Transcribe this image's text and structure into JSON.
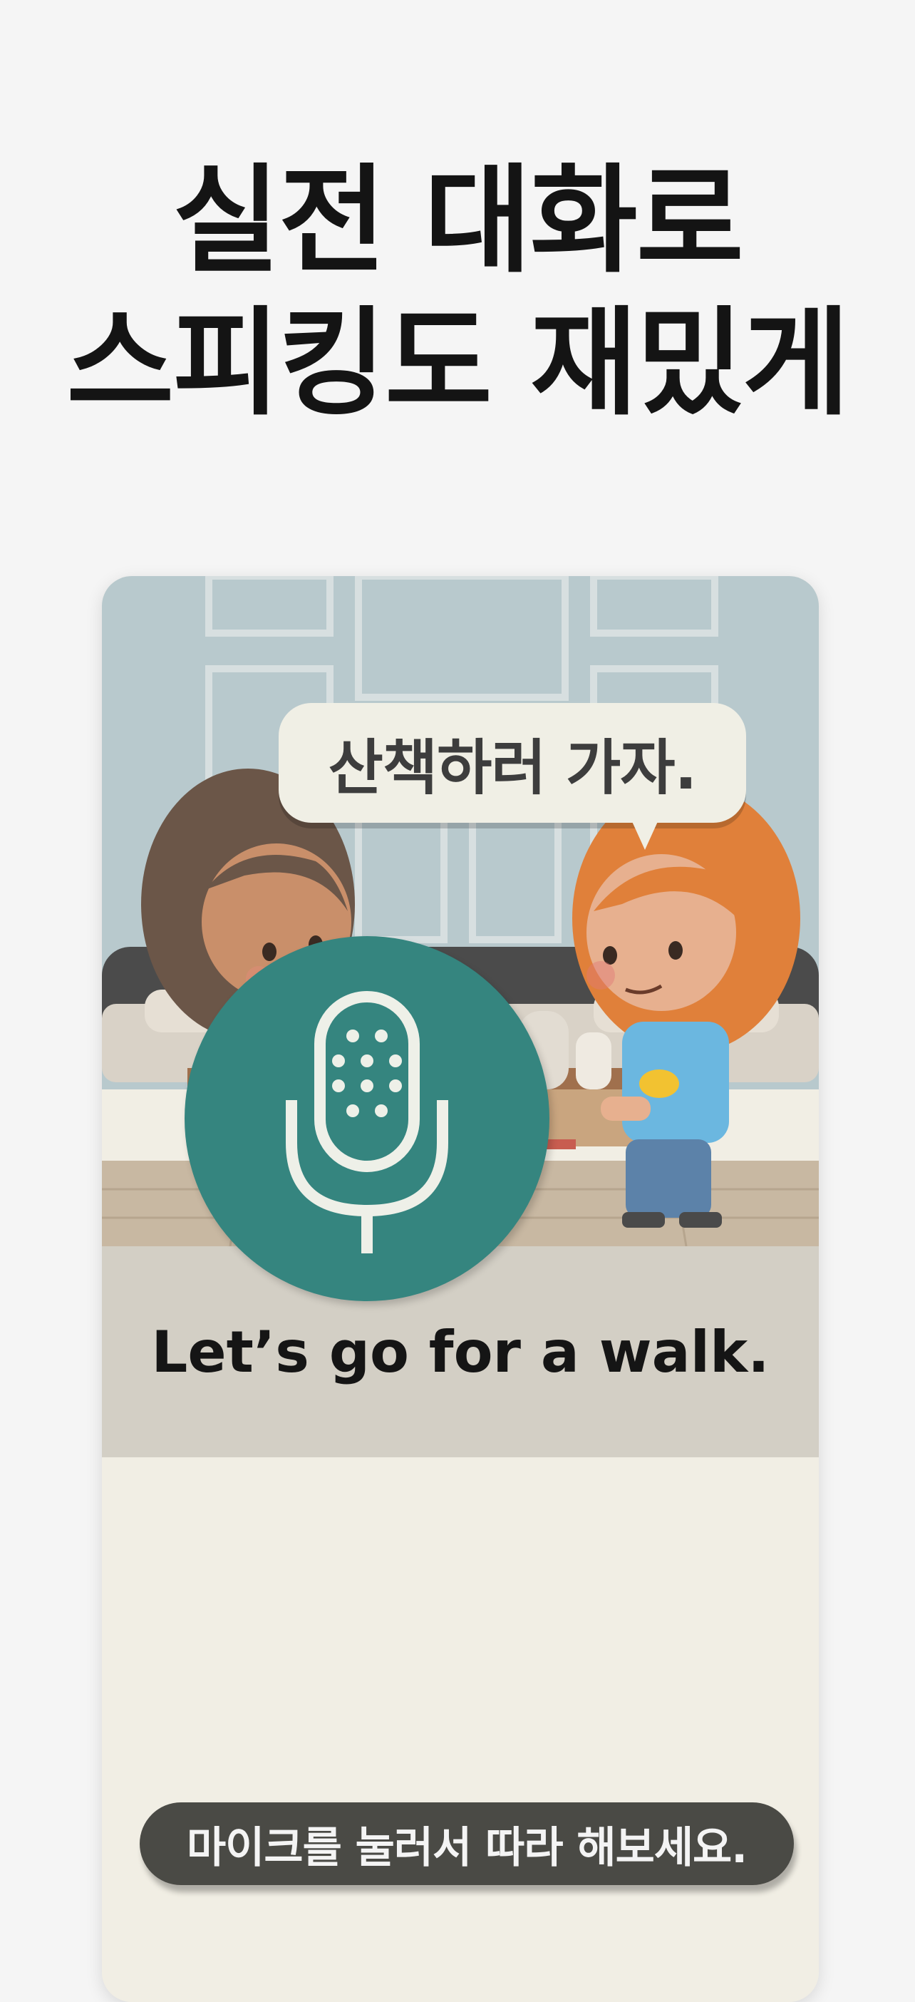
{
  "headline": {
    "line1": "실전 대화로",
    "line2": "스피킹도 재밌게"
  },
  "scene": {
    "speech_bubble": "산책하러 가자.",
    "translation": "Let’s go for a walk."
  },
  "practice": {
    "mic_icon": "microphone-icon",
    "hint": "마이크를 눌러서 따라 해보세요."
  },
  "colors": {
    "page_bg": "#f5f5f5",
    "translation_bar": "#d3cfc5",
    "practice_bg": "#f1eee4",
    "mic_button": "#35857f",
    "hint_pill": "#4a4a45"
  }
}
